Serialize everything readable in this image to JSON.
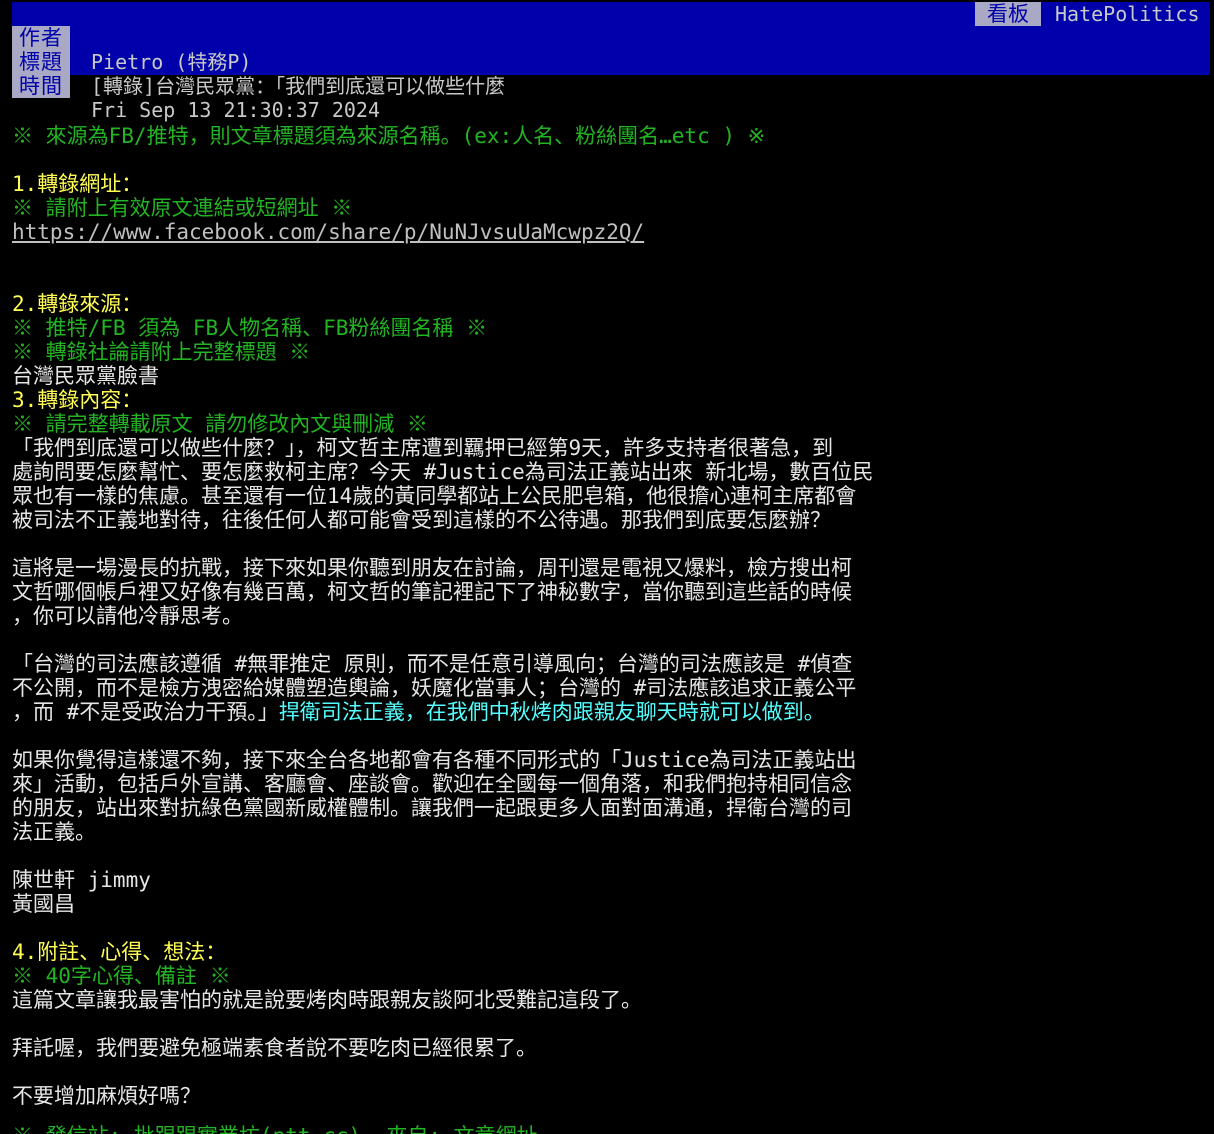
{
  "header": {
    "author_label": "作者",
    "author": "Pietro (特務P)",
    "title_label": "標題",
    "title": "[轉錄]台灣民眾黨：「我們到底還可以做些什麼",
    "time_label": "時間",
    "time": "Fri Sep 13 21:30:37 2024",
    "board_label": "看板",
    "board": "HatePolitics"
  },
  "body": {
    "rule_note": "※ 來源為FB/推特，則文章標題須為來源名稱。(ex:人名、粉絲團名…etc ) ※",
    "s1_heading": "1.轉錄網址：",
    "s1_note": "※ 請附上有效原文連結或短網址 ※",
    "s1_url": "https://www.facebook.com/share/p/NuNJvsuUaMcwpz2Q/",
    "s2_heading": "2.轉錄來源：",
    "s2_note1": "※ 推特/FB 須為 FB人物名稱、FB粉絲團名稱 ※",
    "s2_note2": "※ 轉錄社論請附上完整標題 ※",
    "s2_source": "台灣民眾黨臉書",
    "s3_heading": "3.轉錄內容：",
    "s3_note": "※ 請完整轉載原文 請勿修改內文與刪減 ※",
    "p1": [
      "「我們到底還可以做些什麼？」，柯文哲主席遭到羈押已經第9天，許多支持者很著急，到",
      "處詢問要怎麼幫忙、要怎麼救柯主席？今天 #Justice為司法正義站出來 新北場，數百位民",
      "眾也有一樣的焦慮。甚至還有一位14歲的黃同學都站上公民肥皂箱，他很擔心連柯主席都會",
      "被司法不正義地對待，往後任何人都可能會受到這樣的不公待遇。那我們到底要怎麼辦？"
    ],
    "p2": [
      "這將是一場漫長的抗戰，接下來如果你聽到朋友在討論，周刊還是電視又爆料，檢方搜出柯",
      "文哲哪個帳戶裡又好像有幾百萬，柯文哲的筆記裡記下了神秘數字，當你聽到這些話的時候",
      "，你可以請他冷靜思考。"
    ],
    "p3": [
      "「台灣的司法應該遵循 #無罪推定 原則，而不是任意引導風向；台灣的司法應該是 #偵查",
      "不公開，而不是檢方洩密給媒體塑造輿論，妖魔化當事人；台灣的 #司法應該追求正義公平"
    ],
    "p3_last_white": "，而 #不是受政治力干預。」",
    "p3_last_cyan": "捍衛司法正義，在我們中秋烤肉跟親友聊天時就可以做到。",
    "p4": [
      "如果你覺得這樣還不夠，接下來全台各地都會有各種不同形式的「Justice為司法正義站出",
      "來」活動，包括戶外宣講、客廳會、座談會。歡迎在全國每一個角落，和我們抱持相同信念",
      "的朋友，站出來對抗綠色黨國新威權體制。讓我們一起跟更多人面對面溝通，捍衛台灣的司",
      "法正義。"
    ],
    "sign1": "陳世軒 jimmy",
    "sign2": "黃國昌",
    "s4_heading": "4.附註、心得、想法：",
    "s4_note": "※ 40字心得、備註 ※",
    "c1": "這篇文章讓我最害怕的就是說要烤肉時跟親友談阿北受難記這段了。",
    "c2": "拜託喔，我們要避免極端素食者說不要吃肉已經很累了。",
    "c3": "不要增加麻煩好嗎？",
    "partial": "※ 發信站: 批踢踢實業坊(ptt.cc), 來自: 文章網址"
  }
}
